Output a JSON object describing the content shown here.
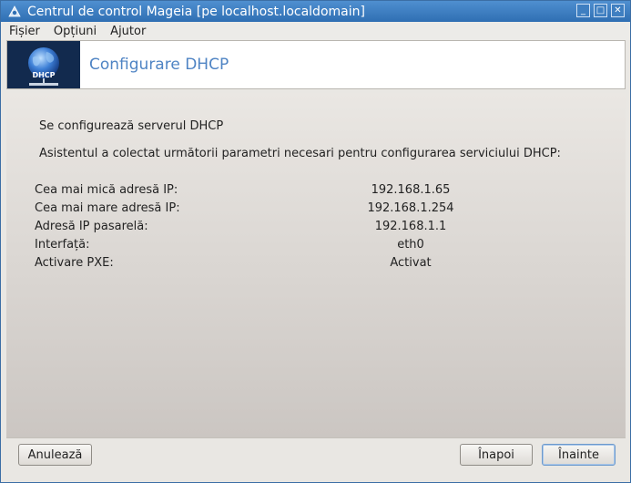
{
  "window": {
    "title": "Centrul de control Mageia  [pe localhost.localdomain]",
    "buttons": [
      "minimize",
      "maximize",
      "close"
    ],
    "button_glyphs": {
      "minimize": "_",
      "maximize": "□",
      "close": "✕"
    }
  },
  "menubar": {
    "items": [
      "Fișier",
      "Opțiuni",
      "Ajutor"
    ]
  },
  "banner": {
    "logo_text": "DHCP",
    "title": "Configurare DHCP"
  },
  "main": {
    "heading": "Se configurează serverul DHCP",
    "intro": "Asistentul a colectat următorii parametri necesari pentru configurarea serviciului DHCP:",
    "params": [
      {
        "label": "Cea mai mică adresă IP:",
        "value": "192.168.1.65"
      },
      {
        "label": "Cea mai mare adresă IP:",
        "value": "192.168.1.254"
      },
      {
        "label": "Adresă IP pasarelă:",
        "value": "192.168.1.1"
      },
      {
        "label": "Interfață:",
        "value": "eth0"
      },
      {
        "label": "Activare PXE:",
        "value": "Activat"
      }
    ]
  },
  "footer": {
    "cancel_label": "Anulează",
    "back_label": "Înapoi",
    "next_label": "Înainte"
  },
  "colors": {
    "titlebar": "#2f6fb3",
    "banner_title": "#4f84c4",
    "logo_bg": "#122a4e"
  }
}
